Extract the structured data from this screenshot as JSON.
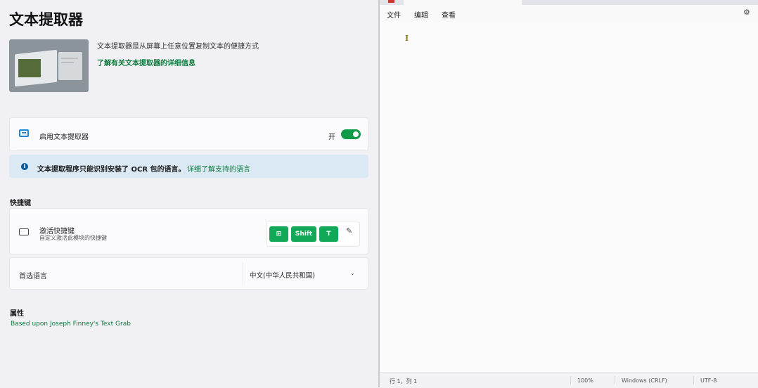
{
  "settings": {
    "title": "文本提取器",
    "description": "文本提取器是从屏幕上任意位置复制文本的便捷方式",
    "learn_more": "了解有关文本提取器的详细信息",
    "enable": {
      "label": "启用文本提取器",
      "state": "开",
      "enabled": true
    },
    "info": {
      "message": "文本提取程序只能识别安装了 OCR 包的语言。",
      "link": "详细了解支持的语言"
    },
    "shortcut_section": "快捷键",
    "shortcut": {
      "title": "激活快捷键",
      "subtitle": "自定义激活此模块的快捷键",
      "keys": [
        "⊞",
        "Shift",
        "T"
      ]
    },
    "language": {
      "label": "首选语言",
      "value": "中文(中华人民共和国)"
    },
    "attribution_section": "属性",
    "attribution_link": "Based upon Joseph Finney's Text Grab",
    "accent_color": "#0f9a47"
  },
  "notepad": {
    "menu": [
      "文件",
      "编辑",
      "查看"
    ],
    "caret": "I",
    "status": {
      "position": "行 1，列 1",
      "zoom": "100%",
      "line_ending": "Windows (CRLF)",
      "encoding": "UTF-8"
    }
  }
}
